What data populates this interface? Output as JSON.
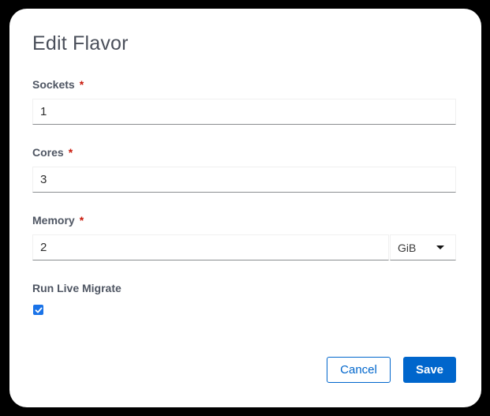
{
  "dialog": {
    "title": "Edit Flavor"
  },
  "fields": {
    "sockets": {
      "label": "Sockets",
      "required_mark": "*",
      "value": "1"
    },
    "cores": {
      "label": "Cores",
      "required_mark": "*",
      "value": "3"
    },
    "memory": {
      "label": "Memory",
      "required_mark": "*",
      "value": "2",
      "unit": "GiB"
    },
    "live_migrate": {
      "label": "Run Live Migrate",
      "checked": true
    }
  },
  "buttons": {
    "cancel": "Cancel",
    "save": "Save"
  },
  "colors": {
    "primary": "#0066cc",
    "required": "#c9190b",
    "checkbox": "#1a73e8"
  }
}
